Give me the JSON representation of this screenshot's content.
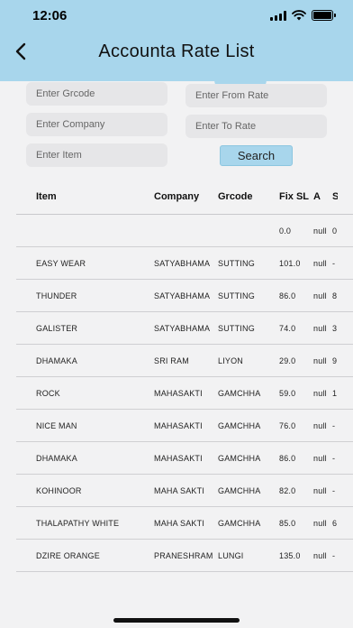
{
  "status_bar": {
    "time": "12:06"
  },
  "nav": {
    "title": "Accounta Rate List"
  },
  "colors": {
    "header": "#a8d6ec",
    "background": "#f2f2f3"
  },
  "filters": {
    "grcode_placeholder": "Enter Grcode",
    "company_placeholder": "Enter Company",
    "item_placeholder": "Enter Item",
    "from_rate_placeholder": "Enter From Rate",
    "to_rate_placeholder": "Enter To Rate",
    "search_label": "Search"
  },
  "table": {
    "headers": [
      "Item",
      "Company",
      "Grcode",
      "Fix SL",
      "A",
      "S"
    ],
    "rows": [
      [
        "",
        "",
        "",
        "0.0",
        "null",
        "0"
      ],
      [
        "EASY WEAR",
        "SATYABHAMA",
        "SUTTING",
        "101.0",
        "null",
        "-"
      ],
      [
        "THUNDER",
        "SATYABHAMA",
        "SUTTING",
        "86.0",
        "null",
        "8"
      ],
      [
        "GALISTER",
        "SATYABHAMA",
        "SUTTING",
        "74.0",
        "null",
        "3"
      ],
      [
        "DHAMAKA",
        "SRI RAM",
        "LIYON",
        "29.0",
        "null",
        "9"
      ],
      [
        "ROCK",
        "MAHASAKTI",
        "GAMCHHA",
        "59.0",
        "null",
        "1"
      ],
      [
        "NICE MAN",
        "MAHASAKTI",
        "GAMCHHA",
        "76.0",
        "null",
        "-"
      ],
      [
        "DHAMAKA",
        "MAHASAKTI",
        "GAMCHHA",
        "86.0",
        "null",
        "-"
      ],
      [
        "KOHINOOR",
        "MAHA SAKTI",
        "GAMCHHA",
        "82.0",
        "null",
        "-"
      ],
      [
        "THALAPATHY WHITE",
        "MAHA SAKTI",
        "GAMCHHA",
        "85.0",
        "null",
        "6"
      ],
      [
        "DZIRE ORANGE",
        "PRANESHRAM",
        "LUNGI",
        "135.0",
        "null",
        "-"
      ]
    ]
  }
}
